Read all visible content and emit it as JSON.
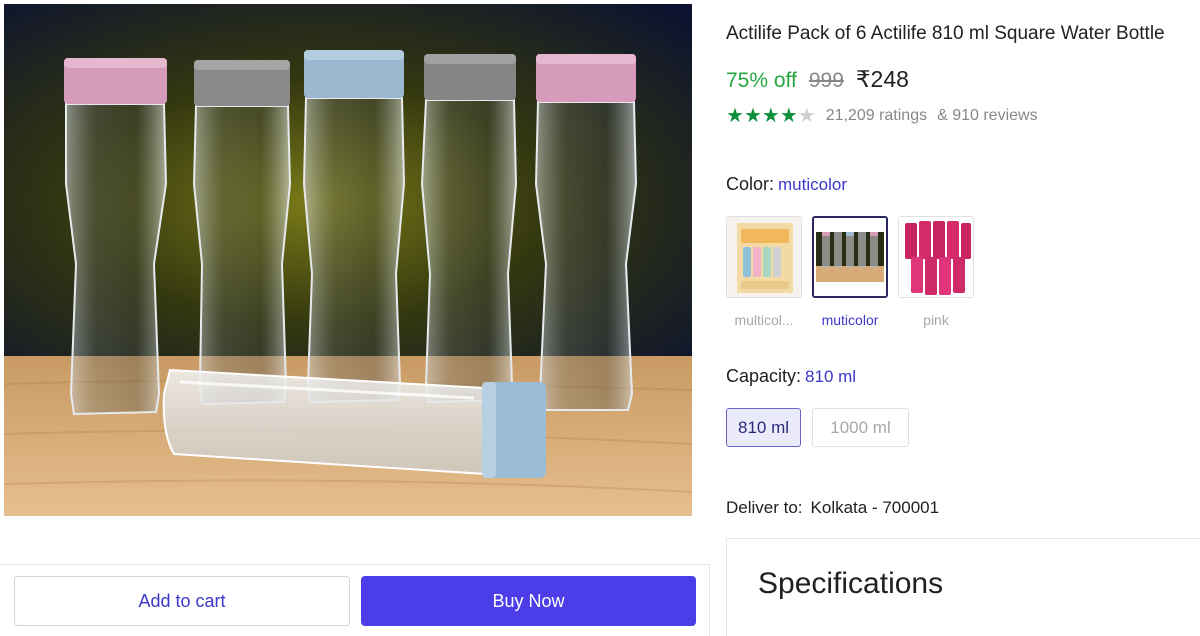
{
  "product": {
    "title": "Actilife Pack of 6 Actilife 810 ml Square Water Bottle",
    "discount": "75% off",
    "mrp": "999",
    "price": "₹248",
    "rating_stars": 4,
    "rating_max": 5,
    "ratings": "21,209 ratings",
    "reviews": "& 910 reviews"
  },
  "color": {
    "label": "Color:",
    "selected": "muticolor",
    "options": [
      {
        "label": "multicol...",
        "icon": "pack-box-thumbnail",
        "active": false
      },
      {
        "label": "muticolor",
        "icon": "bottles-photo-thumbnail",
        "active": true
      },
      {
        "label": "pink",
        "icon": "pink-bottles-thumbnail",
        "active": false
      }
    ]
  },
  "capacity": {
    "label": "Capacity:",
    "selected": "810 ml",
    "options": [
      "810 ml",
      "1000 ml"
    ]
  },
  "delivery": {
    "label": "Deliver to:",
    "location": "Kolkata - 700001"
  },
  "specifications": {
    "title": "Specifications"
  },
  "actions": {
    "add_to_cart": "Add to cart",
    "buy_now": "Buy Now"
  },
  "colors": {
    "accent": "#4b3ee8",
    "link": "#3c37c9",
    "discount_green": "#26a541",
    "star_green": "#0f8f3a"
  }
}
